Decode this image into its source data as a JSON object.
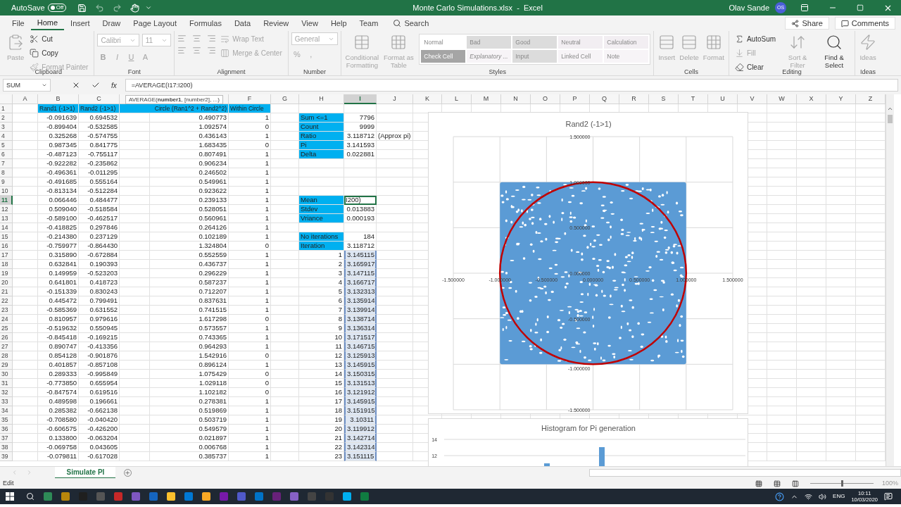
{
  "title_bar": {
    "autosave_label": "AutoSave",
    "autosave_toggle": {
      "label": "Off",
      "on": false
    },
    "title": "Monte Carlo Simulations.xlsx  -  Excel",
    "user": "Olav Sande",
    "avatar": "OS"
  },
  "tabs": [
    {
      "label": "File",
      "selected": false
    },
    {
      "label": "Home",
      "selected": true
    },
    {
      "label": "Insert",
      "selected": false
    },
    {
      "label": "Draw",
      "selected": false
    },
    {
      "label": "Page Layout",
      "selected": false
    },
    {
      "label": "Formulas",
      "selected": false
    },
    {
      "label": "Data",
      "selected": false
    },
    {
      "label": "Review",
      "selected": false
    },
    {
      "label": "View",
      "selected": false
    },
    {
      "label": "Help",
      "selected": false
    },
    {
      "label": "Team",
      "selected": false
    }
  ],
  "search": "Search",
  "share": "Share",
  "comments": "Comments",
  "ribbon": [
    {
      "label": "Clipboard",
      "items": [
        {
          "kind": "large",
          "label": "Paste",
          "disabled": true
        },
        {
          "kind": "small",
          "label": "Cut",
          "disabled": false
        },
        {
          "kind": "small",
          "label": "Copy",
          "disabled": false
        },
        {
          "kind": "small",
          "label": "Format Painter",
          "disabled": true
        }
      ]
    },
    {
      "label": "Font",
      "items": [
        {
          "kind": "row",
          "items": [
            {
              "kind": "field",
              "label": "Calibri",
              "disabled": true
            },
            {
              "kind": "field",
              "label": "11",
              "disabled": true
            }
          ]
        },
        {
          "kind": "glyphs",
          "labels": [
            "B",
            "I",
            "U",
            "A"
          ],
          "disabled": true
        }
      ]
    },
    {
      "label": "Alignment",
      "items": [
        {
          "kind": "align_icons",
          "disabled": true
        },
        {
          "kind": "small",
          "label": "Wrap Text",
          "disabled": true
        },
        {
          "kind": "small",
          "label": "Merge & Center",
          "disabled": true
        }
      ]
    },
    {
      "label": "Number",
      "items": [
        {
          "kind": "field",
          "label": "General",
          "disabled": true
        },
        {
          "kind": "glyphs",
          "labels": [
            "%",
            ","
          ],
          "disabled": true
        }
      ]
    },
    {
      "label": "Styles",
      "items": [
        {
          "kind": "large",
          "label": "Conditional Formatting",
          "disabled": true
        },
        {
          "kind": "large",
          "label": "Format as Table",
          "disabled": true
        }
      ],
      "gallery": [
        {
          "label": "Normal",
          "color": "#ffffff",
          "italic": false
        },
        {
          "label": "Bad",
          "color": "#dcdcdc",
          "italic": false
        },
        {
          "label": "Good",
          "color": "#dcdcdc",
          "italic": false
        },
        {
          "label": "Neutral",
          "color": "#f2eef2",
          "italic": false
        },
        {
          "label": "Calculation",
          "color": "#f2eef2",
          "italic": false
        },
        {
          "label": "Check Cell",
          "color": "#a5a5a5",
          "italic": false
        },
        {
          "label": "Explanatory ...",
          "color": "#f7f4f7",
          "italic": true
        },
        {
          "label": "Input",
          "color": "#dcdcdc",
          "italic": false
        },
        {
          "label": "Linked Cell",
          "color": "#f7f4f7",
          "italic": false
        },
        {
          "label": "Note",
          "color": "#f7f4f7",
          "italic": false
        }
      ]
    },
    {
      "label": "Cells",
      "items": [
        {
          "kind": "large",
          "label": "Insert",
          "disabled": true
        },
        {
          "kind": "large",
          "label": "Delete",
          "disabled": true
        },
        {
          "kind": "large",
          "label": "Format",
          "disabled": true
        }
      ]
    },
    {
      "label": "Editing",
      "items": [
        {
          "kind": "small",
          "label": "AutoSum",
          "disabled": false
        },
        {
          "kind": "small",
          "label": "Fill",
          "disabled": true
        },
        {
          "kind": "small",
          "label": "Clear",
          "disabled": false
        },
        {
          "kind": "large",
          "label": "Sort & Filter",
          "disabled": true
        },
        {
          "kind": "large",
          "label": "Find & Select",
          "disabled": false
        }
      ]
    },
    {
      "label": "Ideas",
      "items": [
        {
          "kind": "large",
          "label": "Ideas",
          "disabled": true
        }
      ]
    }
  ],
  "formula_bar": {
    "name_box": "SUM",
    "function_button": "fx",
    "formula": "=AVERAGE(I17:I200)"
  },
  "function_tooltip": "AVERAGE(**number1**, [number2], ...)",
  "columns": [
    {
      "label": "A",
      "selected": false
    },
    {
      "label": "B",
      "selected": false
    },
    {
      "label": "C",
      "selected": false
    },
    {
      "selected": false
    },
    {
      "selected": false
    },
    {
      "label": "F",
      "selected": false
    },
    {
      "label": "G",
      "selected": false
    },
    {
      "label": "H",
      "selected": false
    },
    {
      "label": "I",
      "selected": true
    },
    {
      "label": "J",
      "selected": false
    },
    {
      "label": "K",
      "selected": false
    },
    {
      "label": "L",
      "selected": false
    },
    {
      "label": "M",
      "selected": false
    },
    {
      "label": "N",
      "selected": false
    },
    {
      "label": "O",
      "selected": false
    },
    {
      "label": "P",
      "selected": false
    },
    {
      "label": "Q",
      "selected": false
    },
    {
      "label": "R",
      "selected": false
    },
    {
      "label": "S",
      "selected": false
    },
    {
      "label": "T",
      "selected": false
    },
    {
      "label": "U",
      "selected": false
    },
    {
      "label": "V",
      "selected": false
    },
    {
      "label": "W",
      "selected": false
    },
    {
      "label": "X",
      "selected": false
    },
    {
      "label": "Y",
      "selected": false
    },
    {
      "label": "Z",
      "selected": false
    }
  ],
  "rows": [
    {
      "n": "1",
      "kind": "header",
      "selected": false,
      "active": false,
      "in_selection": false,
      "b": "Rand1 (-1>1)",
      "c": "Rand2 (-1>1)",
      "e": "Circle (Ran1^2 + Rand2^2)",
      "f": "Within Circle"
    },
    {
      "n": "2",
      "kind": "stat",
      "selected": false,
      "active": false,
      "in_selection": false,
      "b": "-0.091639",
      "c": "0.694532",
      "e": "0.490773",
      "f": "1",
      "h": "Sum <=1",
      "i": "7796"
    },
    {
      "n": "3",
      "kind": "stat",
      "selected": false,
      "active": false,
      "in_selection": false,
      "b": "-0.899404",
      "c": "-0.532585",
      "e": "1.092574",
      "f": "0",
      "h": "Count",
      "i": "9999"
    },
    {
      "n": "4",
      "kind": "stat",
      "selected": false,
      "active": false,
      "in_selection": false,
      "b": "0.325268",
      "c": "-0.574755",
      "e": "0.436143",
      "f": "1",
      "h": "Ratio",
      "i": "3.118712",
      "j": "(Approx pi)"
    },
    {
      "n": "5",
      "kind": "stat",
      "selected": false,
      "active": false,
      "in_selection": false,
      "b": "0.987345",
      "c": "0.841775",
      "e": "1.683435",
      "f": "0",
      "h": "Pi",
      "i": "3.141593"
    },
    {
      "n": "6",
      "kind": "stat",
      "selected": false,
      "active": false,
      "in_selection": false,
      "b": "-0.487123",
      "c": "-0.755117",
      "e": "0.807491",
      "f": "1",
      "h": "Delta",
      "i": "0.022881"
    },
    {
      "n": "7",
      "kind": "plain",
      "selected": false,
      "active": false,
      "in_selection": false,
      "b": "-0.922282",
      "c": "-0.235862",
      "e": "0.906234",
      "f": "1"
    },
    {
      "n": "8",
      "kind": "plain",
      "selected": false,
      "active": false,
      "in_selection": false,
      "b": "-0.496361",
      "c": "-0.011295",
      "e": "0.246502",
      "f": "1"
    },
    {
      "n": "9",
      "kind": "plain",
      "selected": false,
      "active": false,
      "in_selection": false,
      "b": "-0.491685",
      "c": "0.555164",
      "e": "0.549961",
      "f": "1"
    },
    {
      "n": "10",
      "kind": "plain",
      "selected": false,
      "active": false,
      "in_selection": false,
      "b": "-0.813134",
      "c": "-0.512284",
      "e": "0.923622",
      "f": "1"
    },
    {
      "n": "11",
      "kind": "stat",
      "selected": true,
      "active": true,
      "in_selection": false,
      "b": "0.066446",
      "c": "0.484477",
      "e": "0.239133",
      "f": "1",
      "h": "Mean",
      "i": "I200)"
    },
    {
      "n": "12",
      "kind": "stat",
      "selected": false,
      "active": false,
      "in_selection": false,
      "b": "0.509040",
      "c": "-0.518584",
      "e": "0.528051",
      "f": "1",
      "h": "Stdev",
      "i": "0.013883"
    },
    {
      "n": "13",
      "kind": "stat",
      "selected": false,
      "active": false,
      "in_selection": false,
      "b": "-0.589100",
      "c": "-0.462517",
      "e": "0.560961",
      "f": "1",
      "h": "Vriance",
      "i": "0.000193"
    },
    {
      "n": "14",
      "kind": "plain",
      "selected": false,
      "active": false,
      "in_selection": false,
      "b": "-0.418825",
      "c": "0.297846",
      "e": "0.264126",
      "f": "1"
    },
    {
      "n": "15",
      "kind": "stat",
      "selected": false,
      "active": false,
      "in_selection": false,
      "b": "-0.214380",
      "c": "0.237129",
      "e": "0.102189",
      "f": "1",
      "h": "No iterations",
      "i": "184"
    },
    {
      "n": "16",
      "kind": "stat",
      "selected": false,
      "active": false,
      "in_selection": false,
      "b": "-0.759977",
      "c": "-0.864430",
      "e": "1.324804",
      "f": "0",
      "h": "Iteration",
      "i": "3.118712"
    },
    {
      "n": "17",
      "kind": "iteration",
      "selected": false,
      "active": false,
      "in_selection": true,
      "b": "0.315890",
      "c": "-0.672884",
      "e": "0.552559",
      "f": "1",
      "h": "1",
      "i": "3.145115"
    },
    {
      "n": "18",
      "kind": "iteration",
      "selected": false,
      "active": false,
      "in_selection": true,
      "b": "0.632841",
      "c": "0.190393",
      "e": "0.436737",
      "f": "1",
      "h": "2",
      "i": "3.165917"
    },
    {
      "n": "19",
      "kind": "iteration",
      "selected": false,
      "active": false,
      "in_selection": true,
      "b": "0.149959",
      "c": "-0.523203",
      "e": "0.296229",
      "f": "1",
      "h": "3",
      "i": "3.147115"
    },
    {
      "n": "20",
      "kind": "iteration",
      "selected": false,
      "active": false,
      "in_selection": true,
      "b": "0.641801",
      "c": "0.418723",
      "e": "0.587237",
      "f": "1",
      "h": "4",
      "i": "3.166717"
    },
    {
      "n": "21",
      "kind": "iteration",
      "selected": false,
      "active": false,
      "in_selection": true,
      "b": "-0.151339",
      "c": "0.830243",
      "e": "0.712207",
      "f": "1",
      "h": "5",
      "i": "3.132313"
    },
    {
      "n": "22",
      "kind": "iteration",
      "selected": false,
      "active": false,
      "in_selection": true,
      "b": "0.445472",
      "c": "0.799491",
      "e": "0.837631",
      "f": "1",
      "h": "6",
      "i": "3.135914"
    },
    {
      "n": "23",
      "kind": "iteration",
      "selected": false,
      "active": false,
      "in_selection": true,
      "b": "-0.585369",
      "c": "0.631552",
      "e": "0.741515",
      "f": "1",
      "h": "7",
      "i": "3.139914"
    },
    {
      "n": "24",
      "kind": "iteration",
      "selected": false,
      "active": false,
      "in_selection": true,
      "b": "0.810957",
      "c": "0.979616",
      "e": "1.617298",
      "f": "0",
      "h": "8",
      "i": "3.138714"
    },
    {
      "n": "25",
      "kind": "iteration",
      "selected": false,
      "active": false,
      "in_selection": true,
      "b": "-0.519632",
      "c": "0.550945",
      "e": "0.573557",
      "f": "1",
      "h": "9",
      "i": "3.136314"
    },
    {
      "n": "26",
      "kind": "iteration",
      "selected": false,
      "active": false,
      "in_selection": true,
      "b": "-0.845418",
      "c": "-0.169215",
      "e": "0.743365",
      "f": "1",
      "h": "10",
      "i": "3.171517"
    },
    {
      "n": "27",
      "kind": "iteration",
      "selected": false,
      "active": false,
      "in_selection": true,
      "b": "0.890747",
      "c": "-0.413356",
      "e": "0.964293",
      "f": "1",
      "h": "11",
      "i": "3.146715"
    },
    {
      "n": "28",
      "kind": "iteration",
      "selected": false,
      "active": false,
      "in_selection": true,
      "b": "0.854128",
      "c": "-0.901876",
      "e": "1.542916",
      "f": "0",
      "h": "12",
      "i": "3.125913"
    },
    {
      "n": "29",
      "kind": "iteration",
      "selected": false,
      "active": false,
      "in_selection": true,
      "b": "0.401857",
      "c": "-0.857108",
      "e": "0.896124",
      "f": "1",
      "h": "13",
      "i": "3.145915"
    },
    {
      "n": "30",
      "kind": "iteration",
      "selected": false,
      "active": false,
      "in_selection": true,
      "b": "0.289333",
      "c": "-0.995849",
      "e": "1.075429",
      "f": "0",
      "h": "14",
      "i": "3.150315"
    },
    {
      "n": "31",
      "kind": "iteration",
      "selected": false,
      "active": false,
      "in_selection": true,
      "b": "-0.773850",
      "c": "0.655954",
      "e": "1.029118",
      "f": "0",
      "h": "15",
      "i": "3.131513"
    },
    {
      "n": "32",
      "kind": "iteration",
      "selected": false,
      "active": false,
      "in_selection": true,
      "b": "-0.847574",
      "c": "0.619516",
      "e": "1.102182",
      "f": "0",
      "h": "16",
      "i": "3.121912"
    },
    {
      "n": "33",
      "kind": "iteration",
      "selected": false,
      "active": false,
      "in_selection": true,
      "b": "0.489598",
      "c": "0.196661",
      "e": "0.278381",
      "f": "1",
      "h": "17",
      "i": "3.145915"
    },
    {
      "n": "34",
      "kind": "iteration",
      "selected": false,
      "active": false,
      "in_selection": true,
      "b": "0.285382",
      "c": "-0.662138",
      "e": "0.519869",
      "f": "1",
      "h": "18",
      "i": "3.151915"
    },
    {
      "n": "35",
      "kind": "iteration",
      "selected": false,
      "active": false,
      "in_selection": true,
      "b": "-0.708580",
      "c": "-0.040420",
      "e": "0.503719",
      "f": "1",
      "h": "19",
      "i": "3.10311"
    },
    {
      "n": "36",
      "kind": "iteration",
      "selected": false,
      "active": false,
      "in_selection": true,
      "b": "-0.606575",
      "c": "-0.426200",
      "e": "0.549579",
      "f": "1",
      "h": "20",
      "i": "3.119912"
    },
    {
      "n": "37",
      "kind": "iteration",
      "selected": false,
      "active": false,
      "in_selection": true,
      "b": "0.133800",
      "c": "-0.063204",
      "e": "0.021897",
      "f": "1",
      "h": "21",
      "i": "3.142714"
    },
    {
      "n": "38",
      "kind": "iteration",
      "selected": false,
      "active": false,
      "in_selection": true,
      "b": "-0.069758",
      "c": "0.043605",
      "e": "0.006768",
      "f": "1",
      "h": "22",
      "i": "3.142314"
    },
    {
      "n": "39",
      "kind": "iteration",
      "selected": false,
      "active": false,
      "in_selection": true,
      "b": "-0.079811",
      "c": "-0.617028",
      "e": "0.385737",
      "f": "1",
      "h": "23",
      "i": "3.151115"
    }
  ],
  "scatter_chart": {
    "title": "Rand2 (-1>1)",
    "y_ticks": [
      "1.500000",
      "1.000000",
      "0.500000",
      "0.000000",
      "-0.500000",
      "-1.000000",
      "-1.500000"
    ],
    "x_ticks": [
      "-1.500000",
      "-1.000000",
      "-0.500000",
      "0.000000",
      "0.500000",
      "1.000000",
      "1.500000"
    ]
  },
  "histogram": {
    "title": "Histogram for Pi generation",
    "y_ticks": [
      "14",
      "12"
    ]
  },
  "sheet_tabs": [
    {
      "label": "Simulate PI",
      "selected": true
    }
  ],
  "status": {
    "mode": "Edit",
    "zoom_slider": {
      "level": 0.5
    },
    "zoom": "100%"
  },
  "taskbar": {
    "language": "ENG",
    "time": "10:11",
    "date": "10/03/2020"
  }
}
